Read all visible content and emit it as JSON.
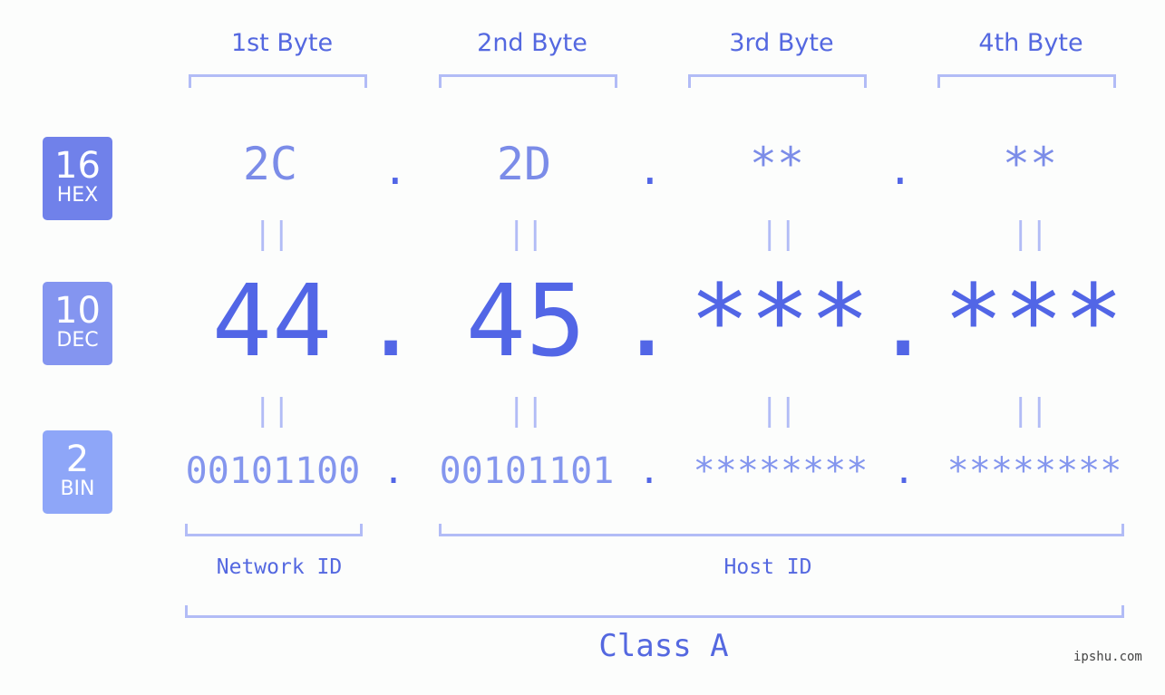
{
  "byte_headers": [
    "1st Byte",
    "2nd Byte",
    "3rd Byte",
    "4th Byte"
  ],
  "badges": [
    {
      "num": "16",
      "label": "HEX",
      "color": "#7081ea"
    },
    {
      "num": "10",
      "label": "DEC",
      "color": "#8495f0"
    },
    {
      "num": "2",
      "label": "BIN",
      "color": "#8ea6f8"
    }
  ],
  "hex": [
    "2C",
    "2D",
    "**",
    "**"
  ],
  "dec": [
    "44",
    "45",
    "***",
    "***"
  ],
  "bin": [
    "00101100",
    "00101101",
    "********",
    "********"
  ],
  "separator": ".",
  "equals": "||",
  "segments": {
    "network": "Network ID",
    "host": "Host ID"
  },
  "class_label": "Class A",
  "watermark": "ipshu.com"
}
